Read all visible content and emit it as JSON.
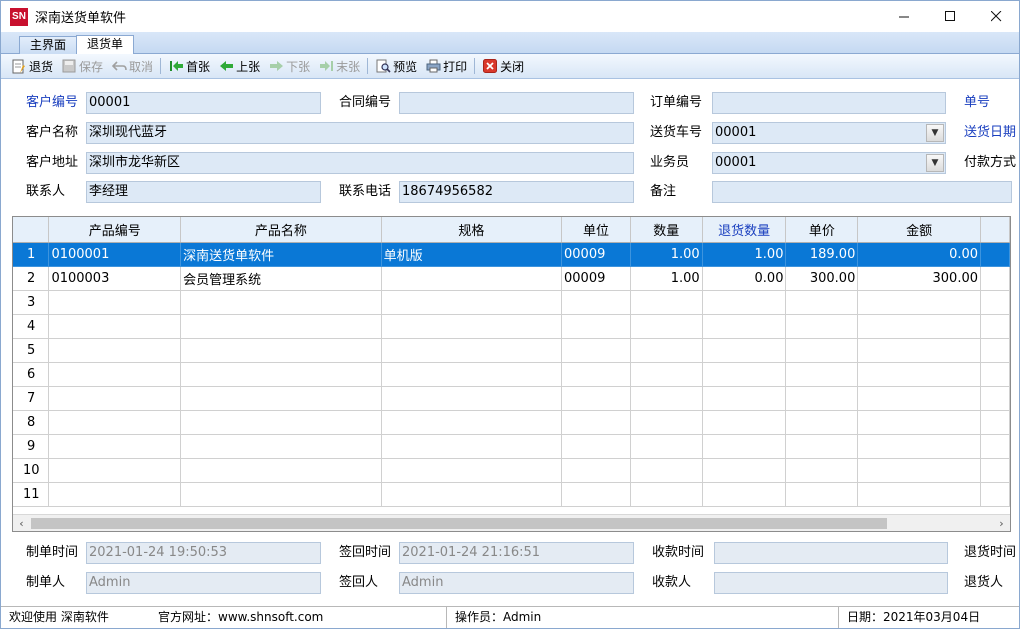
{
  "window": {
    "logo": "SN",
    "title": "深南送货单软件"
  },
  "tabs": [
    {
      "label": "主界面"
    },
    {
      "label": "退货单"
    }
  ],
  "toolbar": {
    "return": "退货",
    "save": "保存",
    "cancel": "取消",
    "first": "首张",
    "prev": "上张",
    "next": "下张",
    "last": "末张",
    "preview": "预览",
    "print": "打印",
    "close": "关闭"
  },
  "form": {
    "customer_no": {
      "label": "客户编号",
      "value": "00001"
    },
    "contract_no": {
      "label": "合同编号",
      "value": ""
    },
    "order_no": {
      "label": "订单编号",
      "value": ""
    },
    "bill_no": {
      "label": "单号"
    },
    "customer_name": {
      "label": "客户名称",
      "value": "深圳现代蓝牙"
    },
    "vehicle_no": {
      "label": "送货车号",
      "value": "00001"
    },
    "delivery_date": {
      "label": "送货日期"
    },
    "customer_addr": {
      "label": "客户地址",
      "value": "深圳市龙华新区"
    },
    "salesman": {
      "label": "业务员",
      "value": "00001"
    },
    "payment": {
      "label": "付款方式"
    },
    "contact": {
      "label": "联系人",
      "value": "李经理"
    },
    "phone": {
      "label": "联系电话",
      "value": "18674956582"
    },
    "remark": {
      "label": "备注",
      "value": ""
    }
  },
  "grid": {
    "columns": [
      "产品编号",
      "产品名称",
      "规格",
      "单位",
      "数量",
      "退货数量",
      "单价",
      "金额"
    ],
    "rows": [
      {
        "no": "1",
        "code": "0100001",
        "name": "深南送货单软件",
        "spec": "单机版",
        "unit": "00009",
        "qty": "1.00",
        "ret": "1.00",
        "price": "189.00",
        "amount": "0.00"
      },
      {
        "no": "2",
        "code": "0100003",
        "name": "会员管理系统",
        "spec": "",
        "unit": "00009",
        "qty": "1.00",
        "ret": "0.00",
        "price": "300.00",
        "amount": "300.00"
      },
      {
        "no": "3"
      },
      {
        "no": "4"
      },
      {
        "no": "5"
      },
      {
        "no": "6"
      },
      {
        "no": "7"
      },
      {
        "no": "8"
      },
      {
        "no": "9"
      },
      {
        "no": "10"
      },
      {
        "no": "11"
      }
    ]
  },
  "footer": {
    "created_time": {
      "label": "制单时间",
      "value": "2021-01-24 19:50:53"
    },
    "signed_time": {
      "label": "签回时间",
      "value": "2021-01-24 21:16:51"
    },
    "collect_time": {
      "label": "收款时间",
      "value": ""
    },
    "return_time": {
      "label": "退货时间"
    },
    "creator": {
      "label": "制单人",
      "value": "Admin"
    },
    "signer": {
      "label": "签回人",
      "value": "Admin"
    },
    "collector": {
      "label": "收款人",
      "value": ""
    },
    "returner": {
      "label": "退货人"
    }
  },
  "status": {
    "welcome": "欢迎使用 深南软件",
    "site": "官方网址：www.shnsoft.com",
    "operator": "操作员：Admin",
    "date": "日期：2021年03月04日"
  }
}
